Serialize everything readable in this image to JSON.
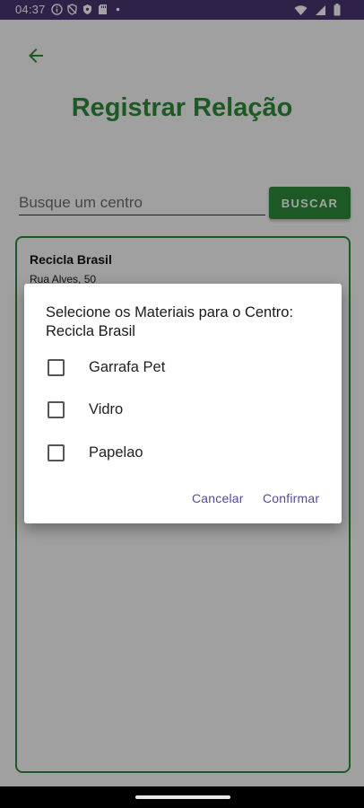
{
  "status_bar": {
    "time": "04:37",
    "left_icons": [
      "info-icon",
      "shield-slash-icon",
      "shield-icon",
      "sd-card-icon",
      "dot-icon"
    ],
    "right_icons": [
      "wifi-icon",
      "signal-icon",
      "battery-icon"
    ]
  },
  "header": {
    "title": "Registrar Relação"
  },
  "search": {
    "placeholder": "Busque um centro",
    "value": "",
    "button_label": "BUSCAR"
  },
  "centers": [
    {
      "name": "Recicla Brasil",
      "address": "Rua Alves, 50"
    }
  ],
  "dialog": {
    "title": "Selecione os Materiais para o Centro: Recicla Brasil",
    "options": [
      {
        "label": "Garrafa Pet",
        "checked": false
      },
      {
        "label": "Vidro",
        "checked": false
      },
      {
        "label": "Papelao",
        "checked": false
      }
    ],
    "cancel_label": "Cancelar",
    "confirm_label": "Confirmar"
  },
  "colors": {
    "status_bar": "#4a3672",
    "primary_green": "#2e8b3a",
    "dialog_action": "#5a4896"
  }
}
